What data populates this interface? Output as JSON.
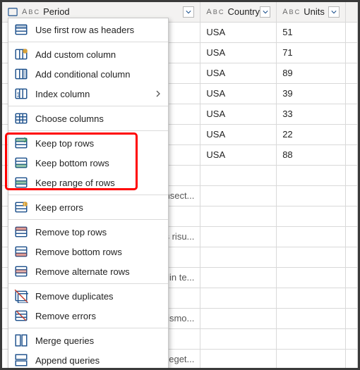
{
  "columns": {
    "period": {
      "label": "Period",
      "type_badge": "ABC"
    },
    "country": {
      "label": "Country",
      "type_badge": "ABC"
    },
    "units": {
      "label": "Units",
      "type_badge": "ABC"
    }
  },
  "rows": [
    {
      "left": "",
      "country": "USA",
      "units": "51"
    },
    {
      "left": "",
      "country": "USA",
      "units": "71"
    },
    {
      "left": "",
      "country": "USA",
      "units": "89"
    },
    {
      "left": "",
      "country": "USA",
      "units": "39"
    },
    {
      "left": "",
      "country": "USA",
      "units": "33"
    },
    {
      "left": "",
      "country": "USA",
      "units": "22"
    },
    {
      "left": "",
      "country": "USA",
      "units": "88"
    },
    {
      "left": "",
      "country": "",
      "units": ""
    },
    {
      "left": "consect...",
      "country": "",
      "units": ""
    },
    {
      "left": "",
      "country": "",
      "units": ""
    },
    {
      "left": "us risu...",
      "country": "",
      "units": ""
    },
    {
      "left": "",
      "country": "",
      "units": ""
    },
    {
      "left": "din te...",
      "country": "",
      "units": ""
    },
    {
      "left": "",
      "country": "",
      "units": ""
    },
    {
      "left": "ismo...",
      "country": "",
      "units": ""
    },
    {
      "left": "",
      "country": "",
      "units": ""
    },
    {
      "left": "t eget...",
      "country": "",
      "units": ""
    }
  ],
  "menu": [
    {
      "id": "use-first-row",
      "label": "Use first row as headers",
      "icon": "headers"
    },
    {
      "sep": true
    },
    {
      "id": "add-custom-col",
      "label": "Add custom column",
      "icon": "addcol"
    },
    {
      "id": "add-cond-col",
      "label": "Add conditional column",
      "icon": "condcol"
    },
    {
      "id": "index-col",
      "label": "Index column",
      "icon": "indexcol",
      "submenu": true
    },
    {
      "sep": true
    },
    {
      "id": "choose-cols",
      "label": "Choose columns",
      "icon": "choose"
    },
    {
      "sep": true
    },
    {
      "id": "keep-top",
      "label": "Keep top rows",
      "icon": "keeptop"
    },
    {
      "id": "keep-bottom",
      "label": "Keep bottom rows",
      "icon": "keepbottom"
    },
    {
      "id": "keep-range",
      "label": "Keep range of rows",
      "icon": "keeprange"
    },
    {
      "sep": true
    },
    {
      "id": "keep-errors",
      "label": "Keep errors",
      "icon": "keeperr"
    },
    {
      "sep": true
    },
    {
      "id": "remove-top",
      "label": "Remove top rows",
      "icon": "remtop"
    },
    {
      "id": "remove-bottom",
      "label": "Remove bottom rows",
      "icon": "rembottom"
    },
    {
      "id": "remove-alt",
      "label": "Remove alternate rows",
      "icon": "remalt"
    },
    {
      "sep": true
    },
    {
      "id": "remove-dup",
      "label": "Remove duplicates",
      "icon": "remdup"
    },
    {
      "id": "remove-err",
      "label": "Remove errors",
      "icon": "remerr"
    },
    {
      "sep": true
    },
    {
      "id": "merge-q",
      "label": "Merge queries",
      "icon": "merge"
    },
    {
      "id": "append-q",
      "label": "Append queries",
      "icon": "append"
    }
  ]
}
